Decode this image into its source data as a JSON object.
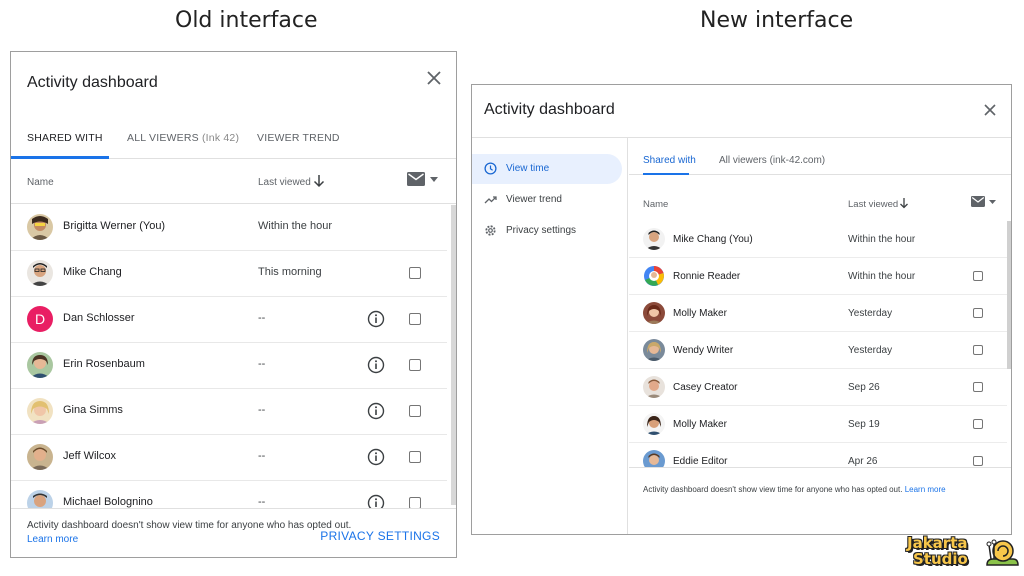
{
  "captions": {
    "old": "Old interface",
    "new": "New interface"
  },
  "old_ui": {
    "title": "Activity dashboard",
    "tabs": [
      "SHARED WITH",
      "ALL VIEWERS",
      "VIEWER TREND"
    ],
    "tab_suffix": "(Ink 42)",
    "columns": {
      "name": "Name",
      "last_viewed": "Last viewed"
    },
    "rows": [
      {
        "name": "Brigitta Werner (You)",
        "last_viewed": "Within the hour",
        "info": false,
        "checkbox": false
      },
      {
        "name": "Mike Chang",
        "last_viewed": "This morning",
        "info": false,
        "checkbox": true
      },
      {
        "name": "Dan Schlosser",
        "last_viewed": "--",
        "info": true,
        "checkbox": true,
        "initial": "D"
      },
      {
        "name": "Erin Rosenbaum",
        "last_viewed": "--",
        "info": true,
        "checkbox": true
      },
      {
        "name": "Gina Simms",
        "last_viewed": "--",
        "info": true,
        "checkbox": true
      },
      {
        "name": "Jeff Wilcox",
        "last_viewed": "--",
        "info": true,
        "checkbox": true
      },
      {
        "name": "Michael Bolognino",
        "last_viewed": "--",
        "info": true,
        "checkbox": true
      }
    ],
    "footer_text": "Activity dashboard doesn't show view time for anyone who has opted out.",
    "learn_more": "Learn more",
    "privacy_button": "PRIVACY SETTINGS"
  },
  "new_ui": {
    "title": "Activity dashboard",
    "nav": [
      "View time",
      "Viewer trend",
      "Privacy settings"
    ],
    "tabs": [
      "Shared with",
      "All viewers (ink-42.com)"
    ],
    "columns": {
      "name": "Name",
      "last_viewed": "Last viewed"
    },
    "rows": [
      {
        "name": "Mike Chang (You)",
        "last_viewed": "Within the hour",
        "checkbox": false
      },
      {
        "name": "Ronnie Reader",
        "last_viewed": "Within the hour",
        "checkbox": true
      },
      {
        "name": "Molly Maker",
        "last_viewed": "Yesterday",
        "checkbox": true
      },
      {
        "name": "Wendy Writer",
        "last_viewed": "Yesterday",
        "checkbox": true
      },
      {
        "name": "Casey Creator",
        "last_viewed": "Sep 26",
        "checkbox": true
      },
      {
        "name": "Molly Maker",
        "last_viewed": "Sep 19",
        "checkbox": true
      },
      {
        "name": "Eddie Editor",
        "last_viewed": "Apr 26",
        "checkbox": true
      }
    ],
    "footer_text": "Activity dashboard doesn't show view time for anyone who has opted out.",
    "learn_more": "Learn more"
  },
  "logo": {
    "line1": "Jakarta",
    "line2": "Studio"
  },
  "colors": {
    "accent": "#1a73e8",
    "active_nav_bg": "#e8f0fe",
    "avatar_pink": "#e91e63",
    "border": "#9e9e9e"
  },
  "icons": [
    "close-icon",
    "sort-down-arrow-icon",
    "mail-icon",
    "dropdown-caret-icon",
    "info-icon",
    "checkbox",
    "clock-icon",
    "trend-icon",
    "gear-icon"
  ]
}
